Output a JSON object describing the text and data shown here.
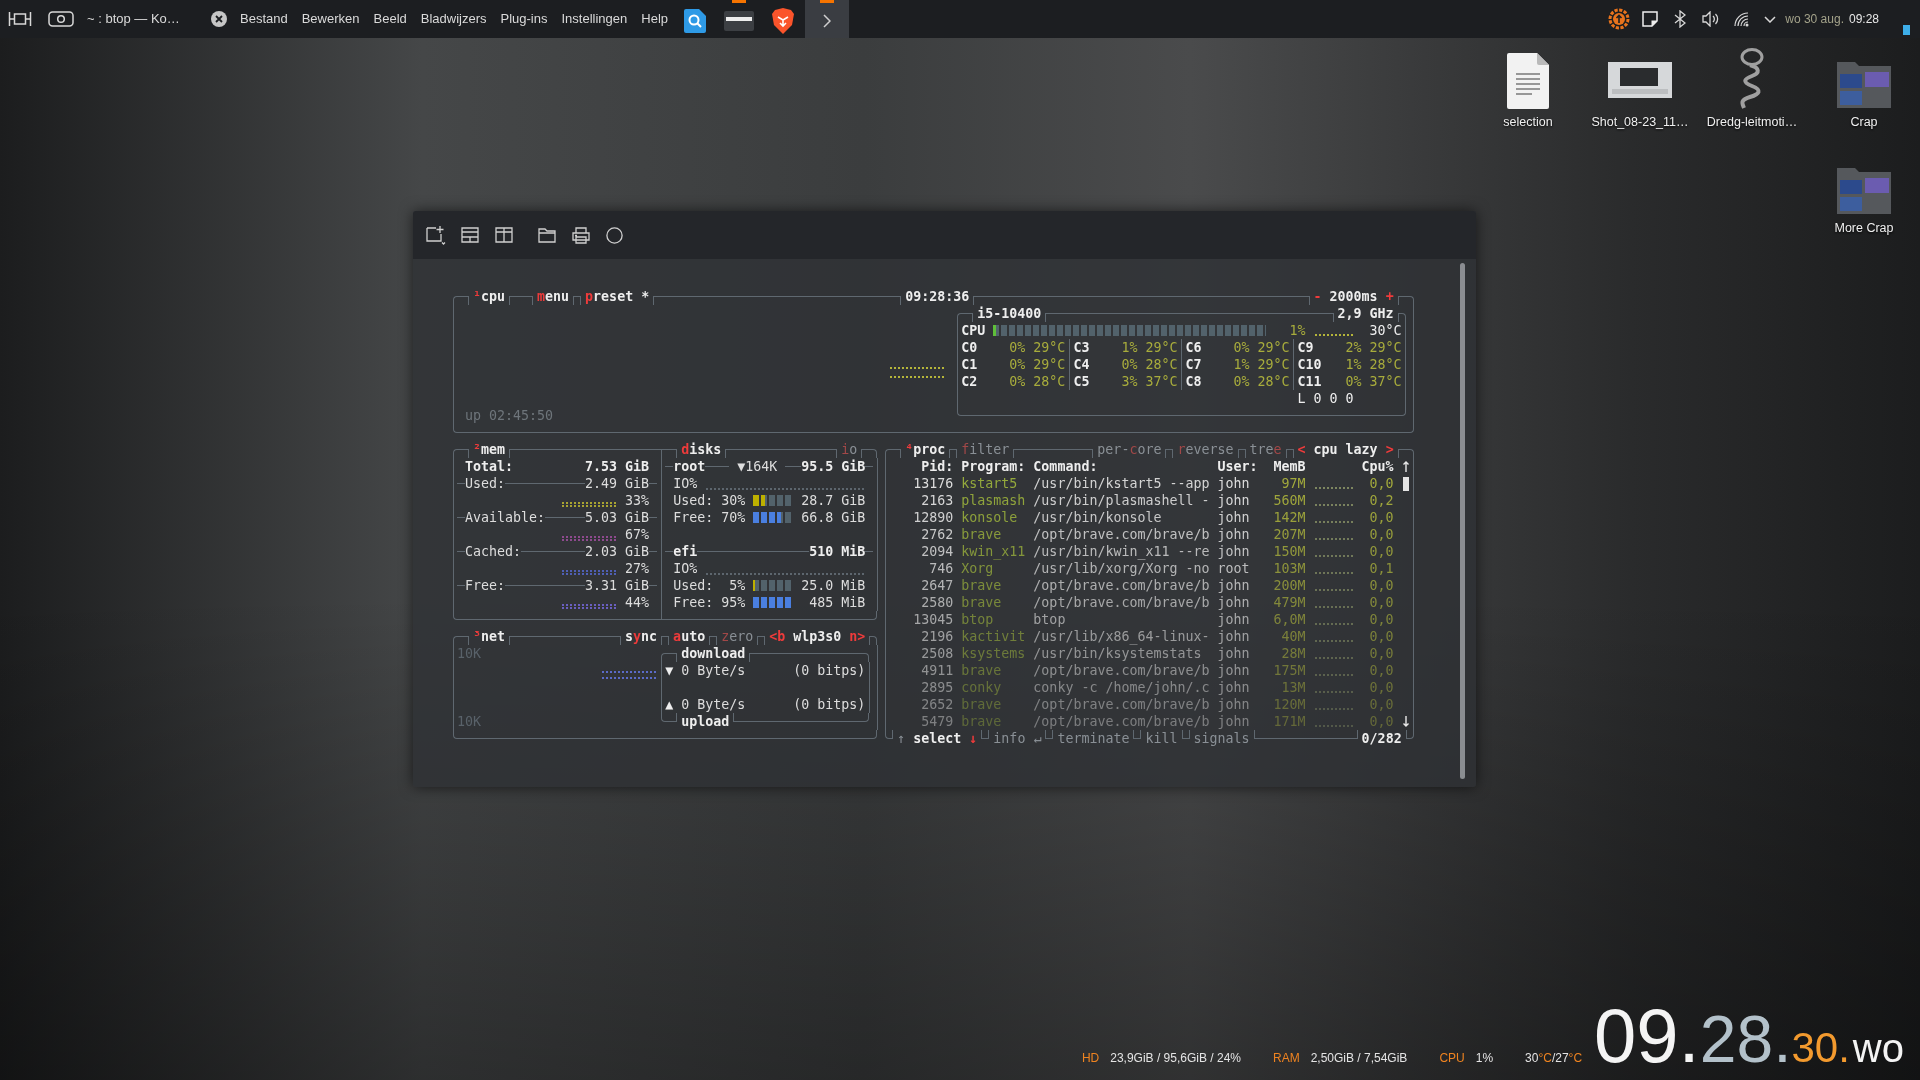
{
  "panel": {
    "task_title": "~ : btop — Ko…",
    "menu": [
      "Bestand",
      "Bewerken",
      "Beeld",
      "Bladwijzers",
      "Plug-ins",
      "Instellingen",
      "Help"
    ],
    "taskbar": [
      {
        "kind": "search",
        "running": false,
        "focused": false
      },
      {
        "kind": "drawer",
        "running": true,
        "focused": false
      },
      {
        "kind": "browser",
        "running": false,
        "focused": false
      },
      {
        "kind": "terminal",
        "running": true,
        "focused": true
      }
    ],
    "date": "wo 30 aug.",
    "time": "09:28"
  },
  "desktop_icons": [
    {
      "label": "selection",
      "kind": "document"
    },
    {
      "label": "Shot_08-23_11…",
      "kind": "image"
    },
    {
      "label": "Dredg-leitmoti…",
      "kind": "audio"
    },
    {
      "label": "Crap",
      "kind": "folder"
    },
    {
      "label": "More Crap",
      "kind": "folder"
    }
  ],
  "btop": {
    "cpu": {
      "header": [
        {
          "number": "¹",
          "parts": [
            {
              "text": "cpu",
              "hotkey": false
            }
          ]
        },
        {
          "parts": [
            {
              "text": "m",
              "hotkey": true
            },
            {
              "text": "enu",
              "hotkey": false
            }
          ]
        },
        {
          "parts": [
            {
              "text": "p",
              "hotkey": true
            },
            {
              "text": "reset *",
              "hotkey": false
            }
          ]
        }
      ],
      "clock": "09:28:36",
      "interval": {
        "parts": [
          {
            "text": "-",
            "hotkey": true
          },
          {
            "text": " 2000ms ",
            "hotkey": false
          },
          {
            "text": "+",
            "hotkey": true
          }
        ]
      },
      "uptime": "up 02:45:50",
      "model": "i5-10400",
      "frequency": "2,9 GHz",
      "total": {
        "label": "CPU",
        "level": 0.01,
        "percent": "1%",
        "temp": "30°C"
      },
      "cores": [
        {
          "name": "C0",
          "percent": "0%",
          "temp": "29°C"
        },
        {
          "name": "C1",
          "percent": "0%",
          "temp": "29°C"
        },
        {
          "name": "C2",
          "percent": "0%",
          "temp": "28°C"
        },
        {
          "name": "C3",
          "percent": "1%",
          "temp": "29°C"
        },
        {
          "name": "C4",
          "percent": "0%",
          "temp": "28°C"
        },
        {
          "name": "C5",
          "percent": "3%",
          "temp": "37°C"
        },
        {
          "name": "C6",
          "percent": "0%",
          "temp": "29°C"
        },
        {
          "name": "C7",
          "percent": "1%",
          "temp": "29°C"
        },
        {
          "name": "C8",
          "percent": "0%",
          "temp": "28°C"
        },
        {
          "name": "C9",
          "percent": "2%",
          "temp": "29°C"
        },
        {
          "name": "C10",
          "percent": "1%",
          "temp": "28°C"
        },
        {
          "name": "C11",
          "percent": "0%",
          "temp": "37°C"
        }
      ],
      "load": "L 0 0 0"
    },
    "mem": {
      "header": {
        "number": "²",
        "parts": [
          {
            "text": "mem",
            "hotkey": false
          }
        ]
      },
      "total": {
        "label": "Total:",
        "value": "7.53 GiB"
      },
      "stats": [
        {
          "label": "Used:",
          "value": "2.49 GiB",
          "percent": "33%",
          "color": "#a8a332"
        },
        {
          "label": "Available:",
          "value": "5.03 GiB",
          "percent": "67%",
          "color": "#8e4a8e"
        },
        {
          "label": "Cached:",
          "value": "2.03 GiB",
          "percent": "27%",
          "color": "#4f5fb5"
        },
        {
          "label": "Free:",
          "value": "3.31 GiB",
          "percent": "44%",
          "color": "#6a5fc0"
        }
      ]
    },
    "disks": {
      "header": {
        "parts": [
          {
            "text": "d",
            "hotkey": true
          },
          {
            "text": "isks",
            "hotkey": false
          }
        ]
      },
      "io_toggle": {
        "on": false,
        "parts": [
          {
            "text": "i",
            "hotkey": true
          },
          {
            "text": "o",
            "hotkey": false
          }
        ]
      },
      "drives": [
        {
          "name": "root",
          "io": "▼164K",
          "size": "95.5 GiB",
          "io_label": "IO%",
          "used": {
            "label": "Used:",
            "percent": "30%",
            "level": 0.3,
            "value": "28.7 GiB"
          },
          "free": {
            "label": "Free:",
            "percent": "70%",
            "level": 0.7,
            "value": "66.8 GiB"
          }
        },
        {
          "name": "efi",
          "size": "510 MiB",
          "io_label": "IO%",
          "used": {
            "label": "Used:",
            "percent": "5%",
            "level": 0.05,
            "value": "25.0 MiB"
          },
          "free": {
            "label": "Free:",
            "percent": "95%",
            "level": 0.95,
            "value": "485 MiB"
          }
        }
      ]
    },
    "net": {
      "header": {
        "number": "³",
        "parts": [
          {
            "text": "net",
            "hotkey": false
          }
        ]
      },
      "options": [
        {
          "on": true,
          "parts": [
            {
              "text": "s",
              "hotkey": false
            },
            {
              "text": "y",
              "hotkey": true
            },
            {
              "text": "nc",
              "hotkey": false
            }
          ]
        },
        {
          "on": true,
          "parts": [
            {
              "text": "a",
              "hotkey": true
            },
            {
              "text": "uto",
              "hotkey": false
            }
          ]
        },
        {
          "on": false,
          "parts": [
            {
              "text": "z",
              "hotkey": true
            },
            {
              "text": "ero",
              "hotkey": false
            }
          ]
        },
        {
          "parts": [
            {
              "text": "<b",
              "hotkey": true
            },
            {
              "text": " wlp3s0 ",
              "hotkey": false
            },
            {
              "text": "n>",
              "hotkey": true
            }
          ]
        }
      ],
      "scale_top": "10K",
      "scale_bottom": "10K",
      "download": {
        "title": "download",
        "arrow": "▼",
        "rate": "0 Byte/s",
        "bits": "(0 bitps)"
      },
      "upload": {
        "title": "upload",
        "arrow": "▲",
        "rate": "0 Byte/s",
        "bits": "(0 bitps)"
      }
    },
    "proc": {
      "header": [
        {
          "number": "⁴",
          "parts": [
            {
              "text": "proc",
              "hotkey": false
            }
          ]
        },
        {
          "on": false,
          "parts": [
            {
              "text": "f",
              "hotkey": true
            },
            {
              "text": "ilter",
              "hotkey": false
            }
          ]
        }
      ],
      "options": [
        {
          "on": false,
          "parts": [
            {
              "text": "per-",
              "hotkey": false
            },
            {
              "text": "c",
              "hotkey": true
            },
            {
              "text": "ore",
              "hotkey": false
            }
          ]
        },
        {
          "on": false,
          "parts": [
            {
              "text": "r",
              "hotkey": true
            },
            {
              "text": "everse",
              "hotkey": false
            }
          ]
        },
        {
          "on": false,
          "parts": [
            {
              "text": "tre",
              "hotkey": false
            },
            {
              "text": "e",
              "hotkey": true
            }
          ]
        },
        {
          "parts": [
            {
              "text": "<",
              "hotkey": true
            },
            {
              "text": " cpu lazy ",
              "hotkey": false
            },
            {
              "text": ">",
              "hotkey": true
            }
          ]
        }
      ],
      "columns": [
        "Pid:",
        "Program:",
        "Command:",
        "User:",
        "MemB",
        "Cpu%"
      ],
      "rows": [
        {
          "pid": "13176",
          "program": "kstart5",
          "command": "/usr/bin/kstart5 --app",
          "user": "john",
          "mem": "97M",
          "cpu": "0,0"
        },
        {
          "pid": "2163",
          "program": "plasmash",
          "command": "/usr/bin/plasmashell -",
          "user": "john",
          "mem": "560M",
          "cpu": "0,2"
        },
        {
          "pid": "12890",
          "program": "konsole",
          "command": "/usr/bin/konsole",
          "user": "john",
          "mem": "142M",
          "cpu": "0,0"
        },
        {
          "pid": "2762",
          "program": "brave",
          "command": "/opt/brave.com/brave/b",
          "user": "john",
          "mem": "207M",
          "cpu": "0,0"
        },
        {
          "pid": "2094",
          "program": "kwin_x11",
          "command": "/usr/bin/kwin_x11 --re",
          "user": "john",
          "mem": "150M",
          "cpu": "0,0"
        },
        {
          "pid": "746",
          "program": "Xorg",
          "command": "/usr/lib/xorg/Xorg -no",
          "user": "root",
          "mem": "103M",
          "cpu": "0,1"
        },
        {
          "pid": "2647",
          "program": "brave",
          "command": "/opt/brave.com/brave/b",
          "user": "john",
          "mem": "200M",
          "cpu": "0,0"
        },
        {
          "pid": "2580",
          "program": "brave",
          "command": "/opt/brave.com/brave/b",
          "user": "john",
          "mem": "479M",
          "cpu": "0,0"
        },
        {
          "pid": "13045",
          "program": "btop",
          "command": "btop",
          "user": "john",
          "mem": "6,0M",
          "cpu": "0,0"
        },
        {
          "pid": "2196",
          "program": "kactivit",
          "command": "/usr/lib/x86_64-linux-",
          "user": "john",
          "mem": "40M",
          "cpu": "0,0"
        },
        {
          "pid": "2508",
          "program": "ksystems",
          "command": "/usr/bin/ksystemstats",
          "user": "john",
          "mem": "28M",
          "cpu": "0,0"
        },
        {
          "pid": "4911",
          "program": "brave",
          "command": "/opt/brave.com/brave/b",
          "user": "john",
          "mem": "175M",
          "cpu": "0,0"
        },
        {
          "pid": "2895",
          "program": "conky",
          "command": "conky -c /home/john/.c",
          "user": "john",
          "mem": "13M",
          "cpu": "0,0"
        },
        {
          "pid": "2652",
          "program": "brave",
          "command": "/opt/brave.com/brave/b",
          "user": "john",
          "mem": "120M",
          "cpu": "0,0"
        },
        {
          "pid": "5479",
          "program": "brave",
          "command": "/opt/brave.com/brave/b",
          "user": "john",
          "mem": "171M",
          "cpu": "0,0"
        }
      ],
      "footer": [
        {
          "disabled": false,
          "parts": [
            {
              "text": "↑",
              "hotkey": false,
              "disabled": true
            },
            {
              "text": " select ",
              "hotkey": false
            },
            {
              "text": "↓",
              "hotkey": true
            }
          ]
        },
        {
          "disabled": true,
          "parts": [
            {
              "text": "info ↵",
              "hotkey": false
            }
          ]
        },
        {
          "disabled": true,
          "parts": [
            {
              "text": "terminate",
              "hotkey": false
            }
          ]
        },
        {
          "disabled": true,
          "parts": [
            {
              "text": "kill",
              "hotkey": false
            }
          ]
        },
        {
          "disabled": true,
          "parts": [
            {
              "text": "signals",
              "hotkey": false
            }
          ]
        }
      ],
      "count": "0/282"
    }
  },
  "conky": {
    "stats": [
      {
        "label": "HD",
        "value": "23,9GiB / 95,6GiB / 24%"
      },
      {
        "label": "RAM",
        "value": "2,50GiB / 7,54GiB"
      },
      {
        "label": "CPU",
        "value": "1%"
      }
    ],
    "temperature": [
      {
        "text": "30",
        "kind": "value"
      },
      {
        "text": "°C",
        "kind": "unit"
      },
      {
        "text": "/27",
        "kind": "value"
      },
      {
        "text": "°C",
        "kind": "unit"
      }
    ],
    "clock": [
      {
        "text": "09.",
        "kind": "hours"
      },
      {
        "text": "28.",
        "kind": "minutes"
      },
      {
        "text": "30.",
        "kind": "seconds"
      },
      {
        "text": "wo",
        "kind": "day"
      }
    ]
  }
}
